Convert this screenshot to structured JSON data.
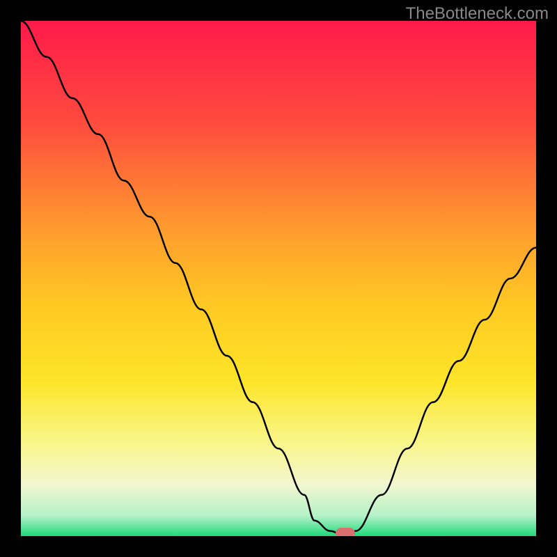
{
  "watermark": "TheBottleneck.com",
  "chart_data": {
    "type": "line",
    "title": "",
    "xlabel": "",
    "ylabel": "",
    "xlim": [
      0,
      100
    ],
    "ylim": [
      0,
      100
    ],
    "x": [
      0,
      5,
      10,
      15,
      20,
      25,
      30,
      35,
      40,
      45,
      50,
      55,
      57,
      60,
      63,
      65,
      70,
      75,
      80,
      85,
      90,
      95,
      100
    ],
    "values": [
      100,
      93,
      85,
      78,
      69,
      62,
      53,
      44,
      35,
      26,
      17,
      8,
      3,
      1,
      0,
      1,
      8,
      17,
      26,
      34,
      42,
      50,
      56
    ],
    "marker": {
      "x": 63,
      "y": 0
    },
    "gradient": {
      "stops": [
        {
          "offset": 0.0,
          "color": "#ff1a4a"
        },
        {
          "offset": 0.2,
          "color": "#ff4b3e"
        },
        {
          "offset": 0.4,
          "color": "#ff9a2e"
        },
        {
          "offset": 0.55,
          "color": "#ffc823"
        },
        {
          "offset": 0.7,
          "color": "#fde528"
        },
        {
          "offset": 0.82,
          "color": "#f9f68b"
        },
        {
          "offset": 0.9,
          "color": "#f2f6d0"
        },
        {
          "offset": 0.96,
          "color": "#b6f2c8"
        },
        {
          "offset": 1.0,
          "color": "#1fd97b"
        }
      ]
    }
  }
}
